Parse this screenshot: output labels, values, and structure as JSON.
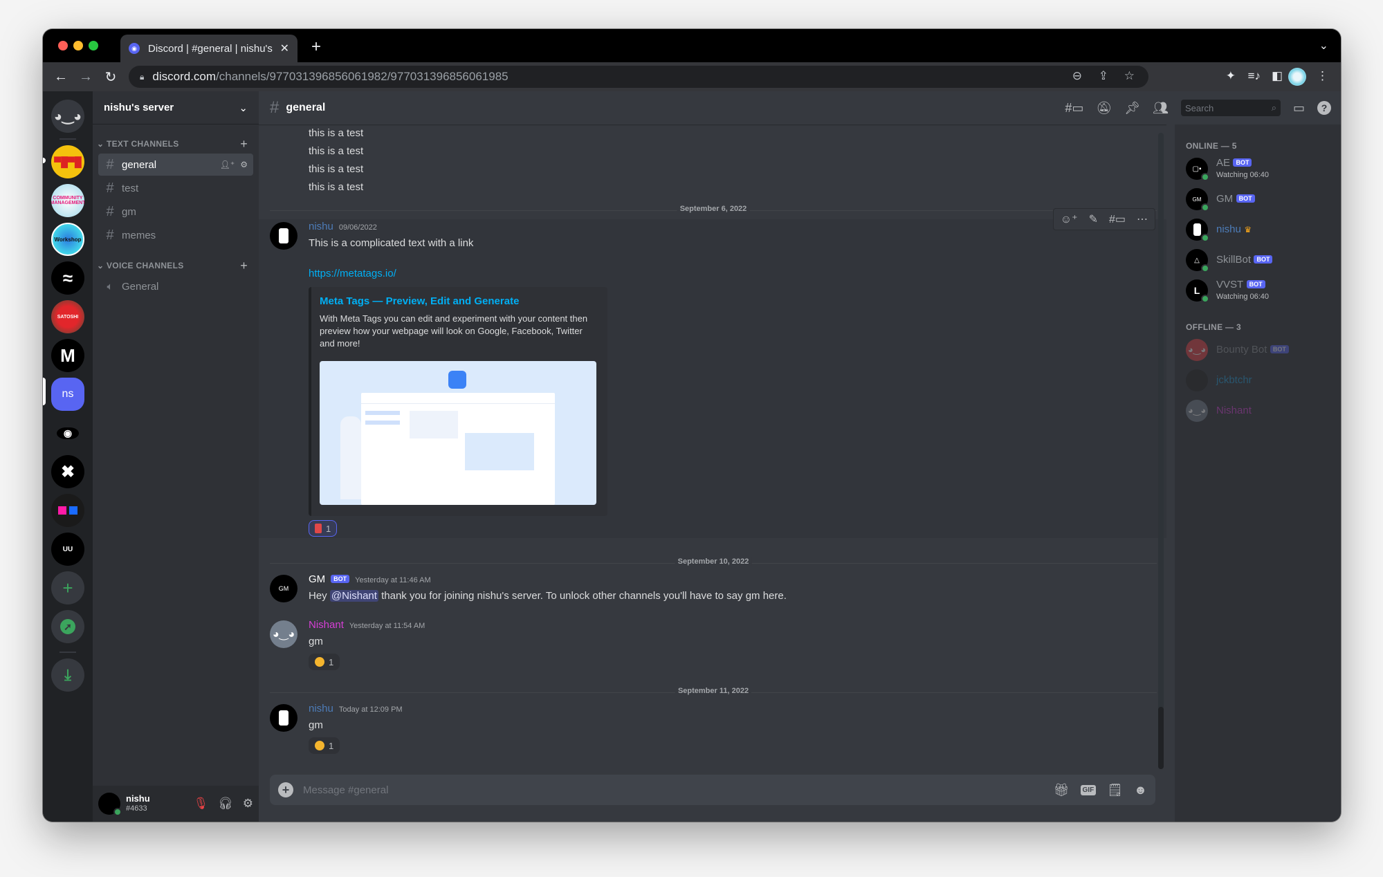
{
  "browser": {
    "tab_title": "Discord | #general | nishu's ser",
    "url_host": "discord.com",
    "url_path": "/channels/977031396856061982/977031396856061985",
    "icons": [
      "back-icon",
      "forward-icon",
      "reload-icon",
      "lock-icon",
      "zoom-out-icon",
      "share-icon",
      "bookmark-star-icon",
      "extensions-icon",
      "media-icon",
      "sidepanel-icon",
      "profile-avatar",
      "menu-icon"
    ]
  },
  "guilds": [
    {
      "name": "home",
      "label": "discord-logo"
    },
    {
      "name": "server-glasses",
      "label": ""
    },
    {
      "name": "server-community-management",
      "label": ""
    },
    {
      "name": "server-workshop",
      "label": ""
    },
    {
      "name": "server-waves",
      "label": "≈"
    },
    {
      "name": "server-red",
      "label": ""
    },
    {
      "name": "server-m",
      "label": "M"
    },
    {
      "name": "server-ns",
      "label": "ns"
    },
    {
      "name": "server-eye",
      "label": ""
    },
    {
      "name": "server-x",
      "label": "✖"
    },
    {
      "name": "server-squares",
      "label": ""
    },
    {
      "name": "server-uu",
      "label": "UU"
    },
    {
      "name": "add-server",
      "label": "+"
    },
    {
      "name": "explore-servers",
      "label": ""
    },
    {
      "name": "download-apps",
      "label": "⤓"
    }
  ],
  "server": {
    "name": "nishu's server",
    "text_category": "TEXT CHANNELS",
    "voice_category": "VOICE CHANNELS",
    "text_channels": [
      "general",
      "test",
      "gm",
      "memes"
    ],
    "voice_channels": [
      "General"
    ]
  },
  "user_panel": {
    "name": "nishu",
    "discriminator": "#4633"
  },
  "channel": {
    "name": "general",
    "search_placeholder": "Search",
    "composer_placeholder": "Message #general"
  },
  "messages": {
    "continued": [
      "this is a test",
      "this is a test",
      "this is a test",
      "this is a test"
    ],
    "groups": [
      {
        "date": "September 6, 2022",
        "author": "nishu",
        "author_color": "#4d7cb8",
        "timestamp": "09/06/2022",
        "text": "This is a complicated text with a link",
        "link": "https://metatags.io/",
        "embed": {
          "title": "Meta Tags — Preview, Edit and Generate",
          "description": "With Meta Tags you can edit and experiment with your content then preview how your webpage will look on Google, Facebook, Twitter and more!"
        },
        "reaction": {
          "emoji": "bookmark",
          "count": "1"
        }
      },
      {
        "date": "September 10, 2022",
        "author": "GM",
        "bot_tag": "BOT",
        "author_color": "#ffffff",
        "timestamp": "Yesterday at 11:46 AM",
        "text_before": "Hey ",
        "mention": "@Nishant",
        "text_after": " thank you for joining nishu's server. To unlock other channels you'll have to say gm here."
      },
      {
        "author": "Nishant",
        "author_color": "#d63fd6",
        "timestamp": "Yesterday at 11:54 AM",
        "text": "gm",
        "reaction": {
          "emoji": "sun",
          "count": "1"
        }
      },
      {
        "date": "September 11, 2022",
        "author": "nishu",
        "author_color": "#4d7cb8",
        "timestamp": "Today at 12:09 PM",
        "text": "gm",
        "reaction": {
          "emoji": "sun",
          "count": "1"
        }
      }
    ]
  },
  "members": {
    "online_label": "ONLINE — 5",
    "offline_label": "OFFLINE — 3",
    "online": [
      {
        "name": "AE",
        "bot": "BOT",
        "status": "Watching 06:40",
        "avatar": "▢▪"
      },
      {
        "name": "GM",
        "bot": "BOT",
        "status": "",
        "avatar": "GM"
      },
      {
        "name": "nishu",
        "bot": "",
        "status": "",
        "avatar": "",
        "color": "#4d7cb8",
        "crown": "♛"
      },
      {
        "name": "SkillBot",
        "bot": "BOT",
        "status": "",
        "avatar": "△"
      },
      {
        "name": "VVST",
        "bot": "BOT",
        "status": "Watching 06:40",
        "avatar": "L"
      }
    ],
    "offline": [
      {
        "name": "Bounty Bot",
        "bot": "BOT",
        "color": "#8e9297"
      },
      {
        "name": "jckbtchr",
        "bot": "",
        "color": "#1f9ad6"
      },
      {
        "name": "Nishant",
        "bot": "",
        "color": "#d63fd6"
      }
    ]
  }
}
